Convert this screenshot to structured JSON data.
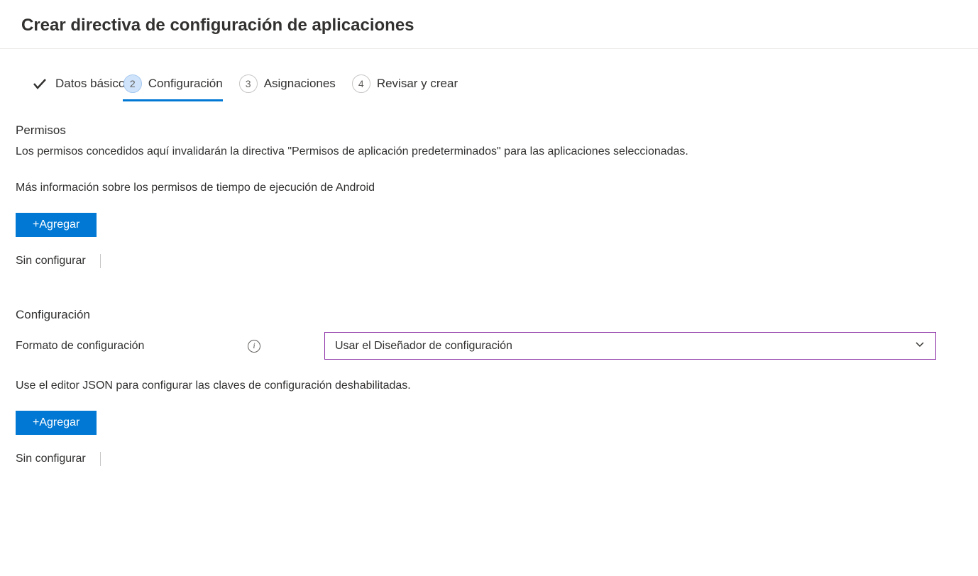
{
  "header": {
    "title": "Crear directiva de configuración de aplicaciones"
  },
  "stepper": {
    "steps": [
      {
        "label": "Datos básicos",
        "state": "complete"
      },
      {
        "label": "Configuración",
        "state": "active",
        "number": "2"
      },
      {
        "label": "Asignaciones",
        "state": "pending",
        "number": "3"
      },
      {
        "label": "Revisar y crear",
        "state": "pending",
        "number": "4"
      }
    ]
  },
  "permissions": {
    "title": "Permisos",
    "description": "Los permisos concedidos aquí invalidarán la directiva \"Permisos de aplicación predeterminados\" para las aplicaciones seleccionadas.",
    "learnMore": "Más información sobre los permisos de tiempo de ejecución de Android",
    "addButton": "+Agregar",
    "status": "Sin configurar"
  },
  "configuration": {
    "title": "Configuración",
    "formatLabel": "Formato de configuración",
    "dropdown": {
      "selected": "Usar el Diseñador de configuración"
    },
    "helpText": "Use el editor JSON para configurar las claves de configuración deshabilitadas.",
    "addButton": "+Agregar",
    "status": "Sin configurar"
  }
}
